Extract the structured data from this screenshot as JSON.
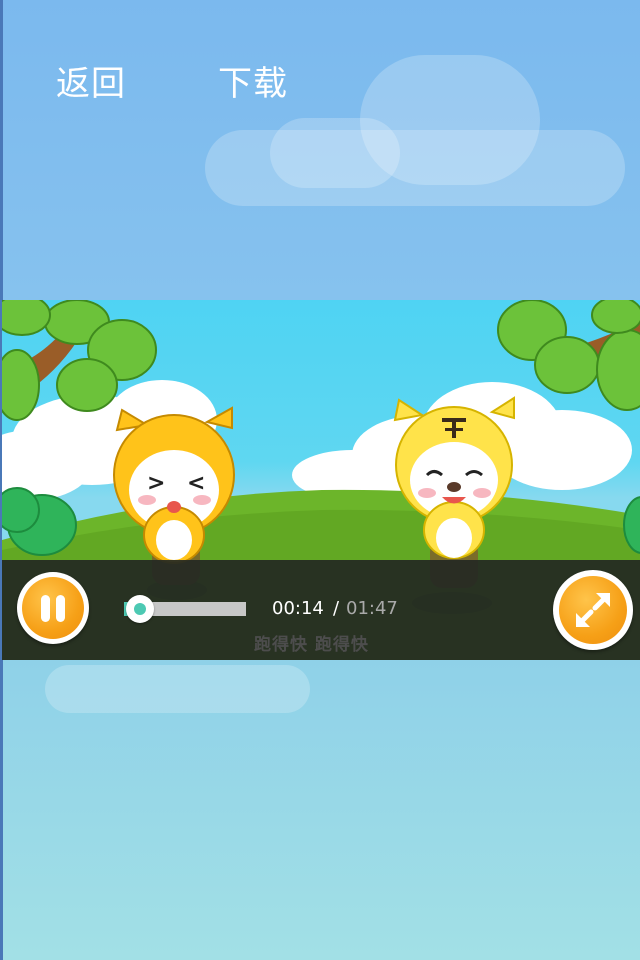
{
  "nav": {
    "back_label": "返回",
    "download_label": "下载"
  },
  "player": {
    "current_time": "00:14",
    "separator": "/",
    "total_time": "01:47",
    "progress": 0.13,
    "subtitle": "跑得快 跑得快"
  },
  "icons": {
    "pause": "pause-icon",
    "fullscreen": "fullscreen-expand-icon"
  },
  "colors": {
    "accent_orange": "#f6a017",
    "progress_teal": "#4dc9b3",
    "sky_blue": "#7bb9ee"
  }
}
